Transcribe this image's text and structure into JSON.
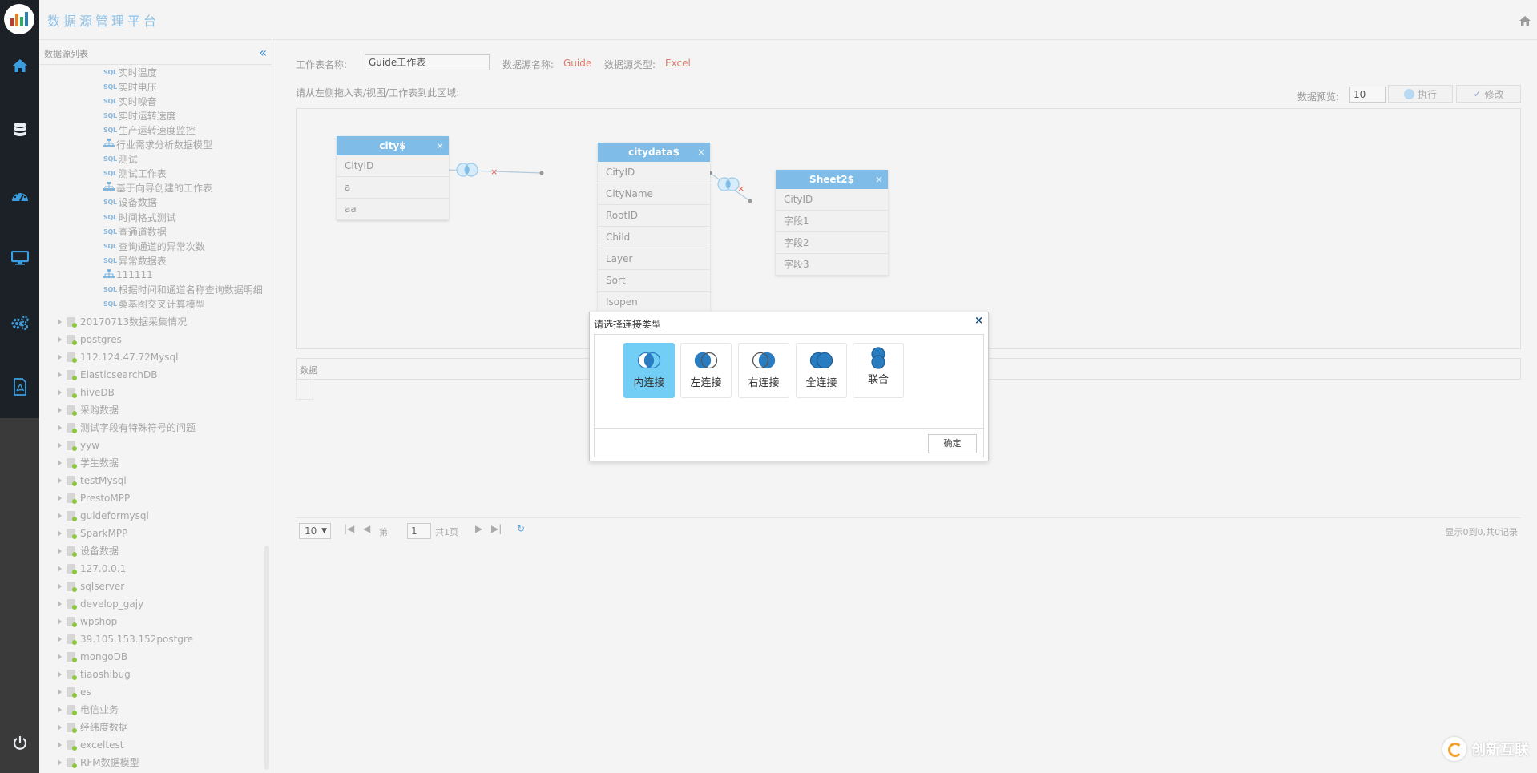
{
  "app": {
    "title": "数据源管理平台"
  },
  "sidebar": {
    "title": "数据源列表",
    "children": [
      {
        "label": "实时温度",
        "icon": "sql-icon"
      },
      {
        "label": "实时电压",
        "icon": "sql-icon"
      },
      {
        "label": "实时噪音",
        "icon": "sql-icon"
      },
      {
        "label": "实时运转速度",
        "icon": "sql-icon"
      },
      {
        "label": "生产运转速度监控",
        "icon": "sql-icon"
      },
      {
        "label": "行业需求分析数据模型",
        "icon": "model-icon"
      },
      {
        "label": "测试",
        "icon": "sql-icon"
      },
      {
        "label": "测试工作表",
        "icon": "sql-icon"
      },
      {
        "label": "基于向导创建的工作表",
        "icon": "model-icon"
      },
      {
        "label": "设备数据",
        "icon": "sql-icon"
      },
      {
        "label": "时间格式测试",
        "icon": "sql-icon"
      },
      {
        "label": "查通道数据",
        "icon": "sql-icon"
      },
      {
        "label": "查询通道的异常次数",
        "icon": "sql-icon"
      },
      {
        "label": "异常数据表",
        "icon": "sql-icon"
      },
      {
        "label": "111111",
        "icon": "model-icon"
      },
      {
        "label": "根据时间和通道名称查询数据明细",
        "icon": "sql-icon"
      },
      {
        "label": "桑基图交叉计算模型",
        "icon": "sql-icon"
      }
    ],
    "sources": [
      "20170713数据采集情况",
      "postgres",
      "112.124.47.72Mysql",
      "ElasticsearchDB",
      "hiveDB",
      "采购数据",
      "测试字段有特殊符号的问题",
      "yyw",
      "学生数据",
      "testMysql",
      "PrestoMPP",
      "guideformysql",
      "SparkMPP",
      "设备数据",
      "127.0.0.1",
      "sqlserver",
      "develop_gajy",
      "wpshop",
      "39.105.153.152postgre",
      "mongoDB",
      "tiaoshibug",
      "es",
      "电信业务",
      "经纬度数据",
      "exceltest",
      "RFM数据模型"
    ]
  },
  "form": {
    "sheet_name_label": "工作表名称:",
    "sheet_name_value": "Guide工作表",
    "ds_name_label": "数据源名称:",
    "ds_name_value": "Guide",
    "ds_type_label": "数据源类型:",
    "ds_type_value": "Excel",
    "hint": "请从左侧拖入表/视图/工作表到此区域:",
    "preview_label": "数据预览:",
    "preview_value": "10",
    "run_label": "执行",
    "edit_label": "修改"
  },
  "tables": [
    {
      "title": "city$",
      "close": "×",
      "fields": [
        "CityID",
        "a",
        "aa"
      ]
    },
    {
      "title": "citydata$",
      "close": "×",
      "fields": [
        "CityID",
        "CityName",
        "RootID",
        "Child",
        "Layer",
        "Sort",
        "Isopen"
      ]
    },
    {
      "title": "Sheet2$",
      "close": "×",
      "fields": [
        "CityID",
        "字段1",
        "字段2",
        "字段3"
      ]
    }
  ],
  "data_panel": {
    "label": "数据"
  },
  "pager": {
    "page_size": "10",
    "page_prefix": "第",
    "page_value": "1",
    "page_total": "共1页",
    "summary": "显示0到0,共0记录"
  },
  "modal": {
    "title": "请选择连接类型",
    "close": "×",
    "options": [
      "内连接",
      "左连接",
      "右连接",
      "全连接",
      "联合"
    ],
    "selected": "内连接",
    "ok_label": "确定"
  },
  "watermark": {
    "text": "创新互联"
  },
  "colors": {
    "accent": "#7fbde8",
    "rail": "#1c2127",
    "active_option": "#72cef4",
    "link_red": "#e07a6a"
  }
}
